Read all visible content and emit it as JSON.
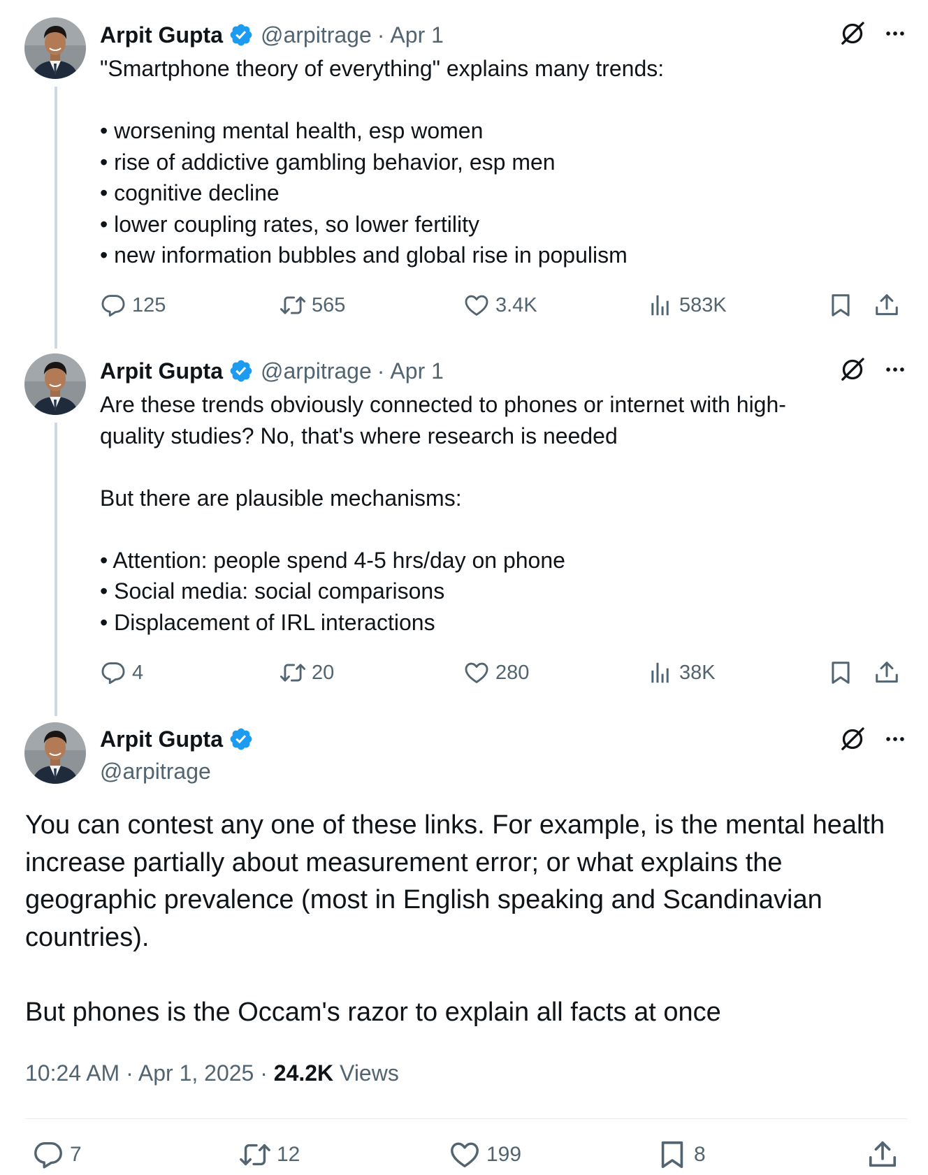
{
  "colors": {
    "verified": "#1d9bf0",
    "muted": "#536471",
    "thread_line": "#cfd9de"
  },
  "tweets": [
    {
      "name": "Arpit Gupta",
      "handle": "@arpitrage",
      "sep": "·",
      "date": "Apr 1",
      "lines": [
        "\"Smartphone theory of everything\" explains many trends:",
        "",
        "• worsening mental health, esp women",
        "• rise of addictive gambling behavior, esp men",
        "• cognitive decline",
        "• lower coupling rates, so lower fertility",
        "• new information bubbles and global rise in populism"
      ],
      "replies": "125",
      "reposts": "565",
      "likes": "3.4K",
      "views": "583K"
    },
    {
      "name": "Arpit Gupta",
      "handle": "@arpitrage",
      "sep": "·",
      "date": "Apr 1",
      "lines": [
        "Are these trends obviously connected to phones or internet with high-",
        "quality studies? No, that's where research is needed",
        "",
        "But there are plausible mechanisms:",
        "",
        "• Attention: people spend 4-5 hrs/day on phone",
        "• Social media: social comparisons",
        "• Displacement of IRL interactions"
      ],
      "replies": "4",
      "reposts": "20",
      "likes": "280",
      "views": "38K"
    }
  ],
  "main": {
    "name": "Arpit Gupta",
    "handle": "@arpitrage",
    "lines": [
      "You can contest any one of these links. For example, is the mental health",
      "increase partially about measurement error; or what explains the",
      "geographic prevalence (most in English speaking and Scandinavian",
      "countries).",
      "",
      "But phones is the Occam's razor to explain all facts at once"
    ],
    "time": "10:24 AM",
    "sep": "·",
    "date": "Apr 1, 2025",
    "views_count": "24.2K",
    "views_label": "Views",
    "replies": "7",
    "reposts": "12",
    "likes": "199",
    "bookmarks": "8"
  }
}
